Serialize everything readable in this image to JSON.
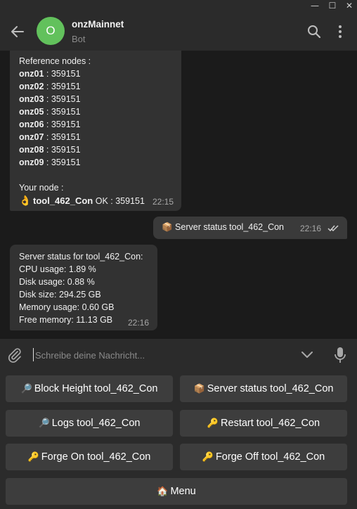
{
  "window": {
    "minimize_glyph": "—",
    "maximize_glyph": "☐",
    "close_glyph": "✕"
  },
  "header": {
    "avatar_letter": "O",
    "avatar_color": "#62c15c",
    "title": "onzMainnet",
    "subtitle": "Bot",
    "icons": [
      "back-arrow-icon",
      "search-icon",
      "more-vertical-icon"
    ]
  },
  "messages": {
    "reference_msg": {
      "heading": "Reference nodes :",
      "nodes": [
        {
          "name": "onz01",
          "value": " : 359151"
        },
        {
          "name": "onz02",
          "value": " : 359151"
        },
        {
          "name": "onz03",
          "value": " : 359151"
        },
        {
          "name": "onz05",
          "value": " : 359151"
        },
        {
          "name": "onz06",
          "value": " : 359151"
        },
        {
          "name": "onz07",
          "value": " : 359151"
        },
        {
          "name": "onz08",
          "value": " : 359151"
        },
        {
          "name": "onz09",
          "value": " : 359151"
        }
      ],
      "your_node_label": "Your node :",
      "your_node_emoji": "👌",
      "your_node_name": "tool_462_Con",
      "your_node_status": " OK : 359151",
      "time": "22:15"
    },
    "outgoing_msg": {
      "emoji": "📦",
      "text": " Server status tool_462_Con",
      "time": "22:16",
      "read_status": "double-check-icon"
    },
    "status_msg": {
      "lines": [
        "Server status for tool_462_Con:",
        "CPU usage: 1.89 %",
        "Disk usage: 0.88 %",
        "Disk size: 294.25 GB",
        "Memory usage: 0.60 GB",
        "Free memory: 11.13 GB"
      ],
      "time": "22:16"
    }
  },
  "composer": {
    "placeholder": "Schreibe deine Nachricht...",
    "value": "",
    "icons": [
      "paperclip-icon",
      "chevron-down-icon",
      "microphone-icon"
    ]
  },
  "keyboard": {
    "buttons": [
      {
        "emoji": "🔎",
        "label": "Block Height tool_462_Con"
      },
      {
        "emoji": "📦",
        "label": "Server status tool_462_Con"
      },
      {
        "emoji": "🔎",
        "label": "Logs tool_462_Con"
      },
      {
        "emoji": "🔑",
        "label": "Restart tool_462_Con"
      },
      {
        "emoji": "🔑",
        "label": "Forge On tool_462_Con"
      },
      {
        "emoji": "🔑",
        "label": "Forge Off tool_462_Con"
      },
      {
        "emoji": "🏠",
        "label": "Menu"
      }
    ]
  }
}
